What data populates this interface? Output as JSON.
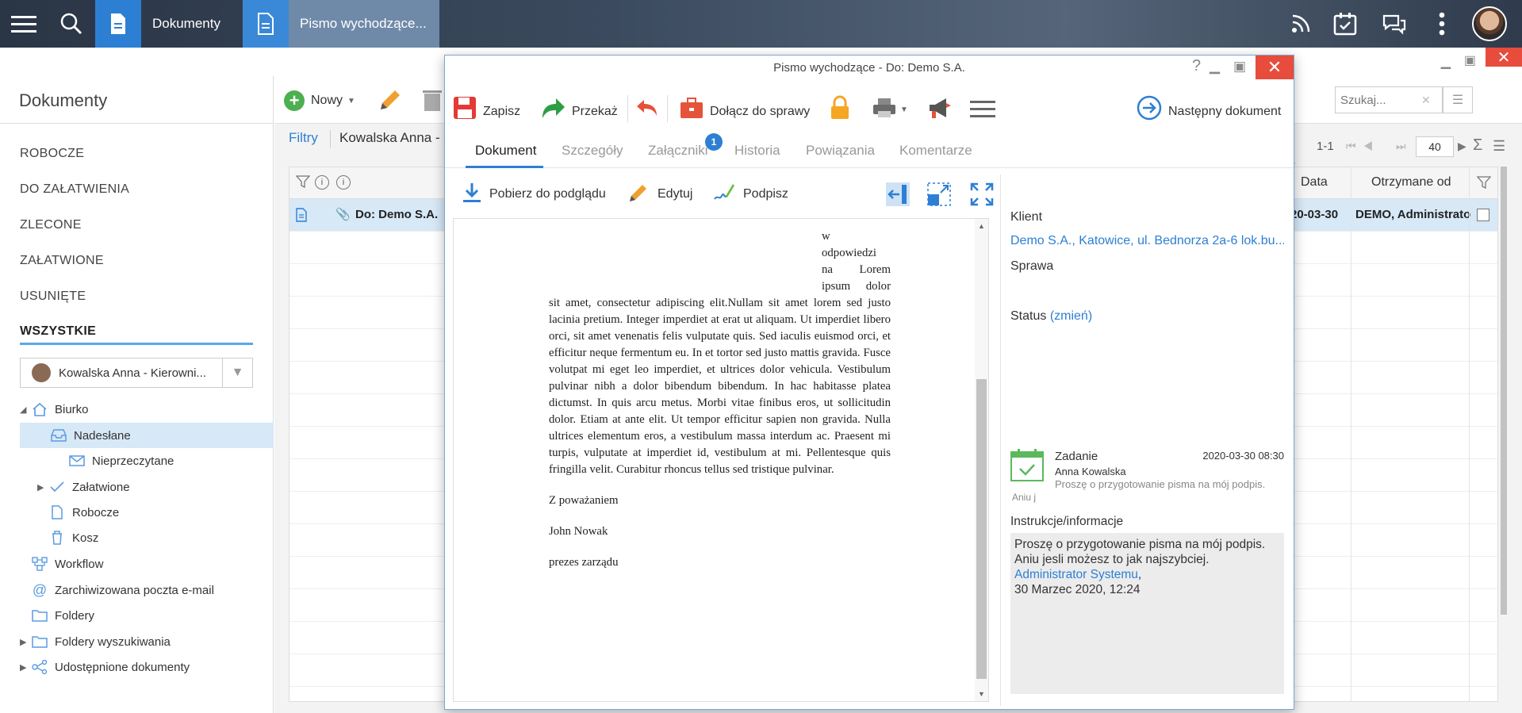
{
  "topbar": {
    "tab1_label": "Dokumenty",
    "tab2_label": "Pismo wychodzące...",
    "colors": {
      "accent": "#2d7fd3",
      "close": "#e74c3c"
    }
  },
  "left": {
    "title": "Dokumenty",
    "nav": [
      "ROBOCZE",
      "DO ZAŁATWIENIA",
      "ZLECONE",
      "ZAŁATWIONE",
      "USUNIĘTE",
      "WSZYSTKIE"
    ],
    "user_select": "Kowalska Anna - Kierowni...",
    "tree": [
      {
        "label": "Biurko"
      },
      {
        "label": "Nadesłane"
      },
      {
        "label": "Nieprzeczytane"
      },
      {
        "label": "Załatwione"
      },
      {
        "label": "Robocze"
      },
      {
        "label": "Kosz"
      },
      {
        "label": "Workflow"
      },
      {
        "label": "Zarchiwizowana poczta e-mail"
      },
      {
        "label": "Foldery"
      },
      {
        "label": "Foldery wyszukiwania"
      },
      {
        "label": "Udostępnione dokumenty"
      }
    ]
  },
  "main": {
    "new_label": "Nowy",
    "filters_label": "Filtry",
    "filter_user": "Kowalska Anna -",
    "search_placeholder": "Szukaj...",
    "paging": "1-1",
    "page_size": "40",
    "col_date": "Data",
    "col_from": "Otrzymane od",
    "row_title": "Do: Demo S.A.",
    "row_date": "20-03-30",
    "row_from": "DEMO, Administrato"
  },
  "modal": {
    "title": "Pismo wychodzące - Do: Demo S.A.",
    "toolbar": {
      "save": "Zapisz",
      "forward": "Przekaż",
      "attach": "Dołącz do sprawy",
      "next": "Następny dokument"
    },
    "tabs": [
      "Dokument",
      "Szczegóły",
      "Załączniki",
      "Historia",
      "Powiązania",
      "Komentarze"
    ],
    "attachments_count": "1",
    "subtoolbar": {
      "download": "Pobierz do podglądu",
      "edit": "Edytuj",
      "sign": "Podpisz"
    },
    "letter": {
      "narrow_lines": [
        "w",
        "odpowiedzi",
        "na Lorem",
        "ipsum dolor"
      ],
      "body": "sit amet, consectetur adipiscing elit.Nullam sit amet lorem sed justo lacinia pretium. Integer imperdiet at erat ut aliquam. Ut imperdiet libero orci, sit amet venenatis felis vulputate quis. Sed iaculis euismod orci, et efficitur neque fermentum eu. In et tortor sed justo mattis gravida. Fusce volutpat mi eget leo imperdiet, et ultrices dolor vehicula. Vestibulum pulvinar nibh a dolor bibendum bibendum. In hac habitasse platea dictumst. In quis arcu metus. Morbi vitae finibus eros, ut sollicitudin dolor. Etiam at ante elit. Ut tempor efficitur sapien non gravida. Nulla ultrices elementum eros, a vestibulum massa interdum ac. Praesent mi turpis, vulputate at imperdiet id, vestibulum at mi. Pellentesque quis fringilla velit. Curabitur rhoncus tellus sed tristique pulvinar.",
      "closing": "Z poważaniem",
      "signer": "John Nowak",
      "role": "prezes zarządu"
    },
    "details": {
      "client_label": "Klient",
      "client_value": "Demo S.A., Katowice, ul. Bednorza 2a-6 lok.bu...",
      "case_label": "Sprawa",
      "status_label": "Status",
      "status_change": "(zmień)",
      "task_label": "Zadanie",
      "task_date": "2020-03-30 08:30",
      "task_person": "Anna Kowalska",
      "task_desc": "Proszę o przygotowanie pisma na mój podpis.",
      "task_note": "Aniu j",
      "instr_label": "Instrukcje/informacje",
      "instr_text": "Proszę o przygotowanie pisma na mój podpis. Aniu jesli możesz to jak najszybciej.",
      "instr_author": "Administrator Systemu",
      "instr_date": "30 Marzec 2020, 12:24"
    }
  }
}
